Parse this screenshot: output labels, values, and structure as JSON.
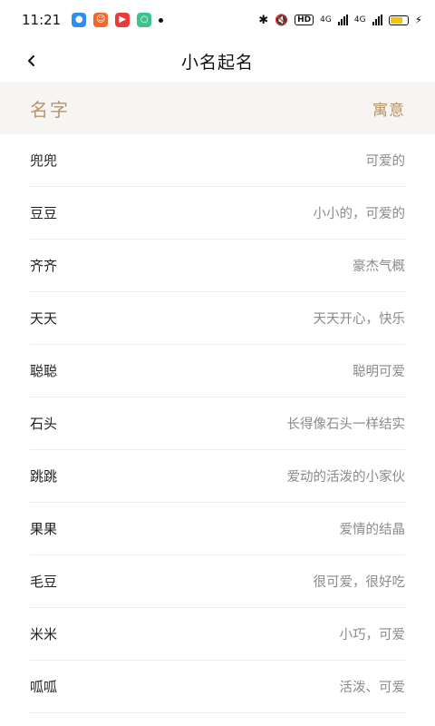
{
  "status_bar": {
    "time": "11:21",
    "network_label_1": "4G",
    "network_label_2": "4G",
    "hd_label": "HD"
  },
  "nav": {
    "title": "小名起名"
  },
  "table": {
    "header_name": "名字",
    "header_meaning": "寓意",
    "rows": [
      {
        "name": "兜兜",
        "meaning": "可爱的"
      },
      {
        "name": "豆豆",
        "meaning": "小小的，可爱的"
      },
      {
        "name": "齐齐",
        "meaning": "豪杰气概"
      },
      {
        "name": "天天",
        "meaning": "天天开心，快乐"
      },
      {
        "name": "聪聪",
        "meaning": "聪明可爱"
      },
      {
        "name": "石头",
        "meaning": "长得像石头一样结实"
      },
      {
        "name": "跳跳",
        "meaning": "爱动的活泼的小家伙"
      },
      {
        "name": "果果",
        "meaning": "爱情的结晶"
      },
      {
        "name": "毛豆",
        "meaning": "很可爱，很好吃"
      },
      {
        "name": "米米",
        "meaning": "小巧，可爱"
      },
      {
        "name": "呱呱",
        "meaning": "活泼、可爱"
      }
    ]
  },
  "colors": {
    "accent": "#b59468",
    "header_bg": "#f7f5f1"
  }
}
